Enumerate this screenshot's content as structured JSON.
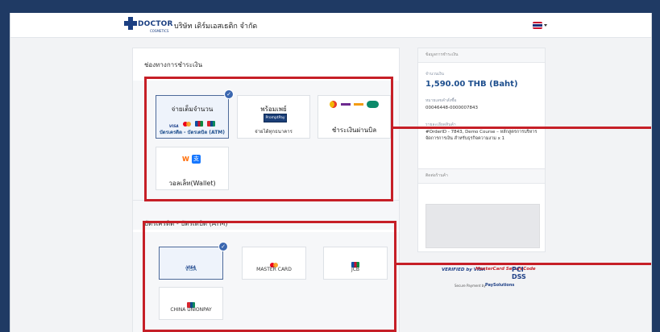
{
  "header": {
    "logo_word": "DOCTOR",
    "logo_sub": "COSMETICS",
    "company_name": "บริษัท เดิร์มเอสเธติก จำกัด",
    "language_icon": "thai-flag-icon"
  },
  "payment_channels": {
    "title": "ช่องทางการชำระเงิน",
    "options": [
      {
        "title": "จ่ายเต็มจำนวน",
        "caption": "บัตรเครดิต - บัตรเดบิต (ATM)",
        "selected": true
      },
      {
        "title": "พร้อมเพย์",
        "caption": "จ่ายได้ทุกธนาคาร",
        "badge": "PromptPay",
        "selected": false
      },
      {
        "title": "ชำระเงินผ่านบิล",
        "selected": false
      },
      {
        "title": "วอลเล็ท(Wallet)",
        "selected": false
      }
    ]
  },
  "card_section": {
    "title": "บัตรเครดิต - บัตรเดบิต (ATM)",
    "cards": [
      {
        "label": "VISA",
        "selected": true
      },
      {
        "label": "MASTER CARD",
        "selected": false
      },
      {
        "label": "JCB",
        "selected": false
      },
      {
        "label": "CHINA UNIONPAY",
        "selected": false
      }
    ]
  },
  "summary": {
    "head": "ข้อมูลการชำระเงิน",
    "amount_label": "จำนวนเงิน",
    "amount": "1,590.00 THB (Baht)",
    "order_label": "หมายเลขคำสั่งซื้อ",
    "order_number": "00046448-0000007843",
    "product_label": "รายละเอียดสินค้า",
    "product_detail": "#OrderID - 7843, Demo Course – หลักสูตรการบริหารจัดการการเงิน สำหรับธุรกิจความงาม x 1"
  },
  "contact": {
    "head": "ติดต่อร้านค้า"
  },
  "security": {
    "verified": "VERIFIED by VISA",
    "mastercard": "MasterCard SecureCode",
    "pci": "PCI DSS",
    "secure_by": "Secure Payment by",
    "brand": "PaySolutions"
  },
  "colors": {
    "accent": "#1e4f8e",
    "highlight": "#c61f27",
    "page_bg": "#1f3a64"
  }
}
